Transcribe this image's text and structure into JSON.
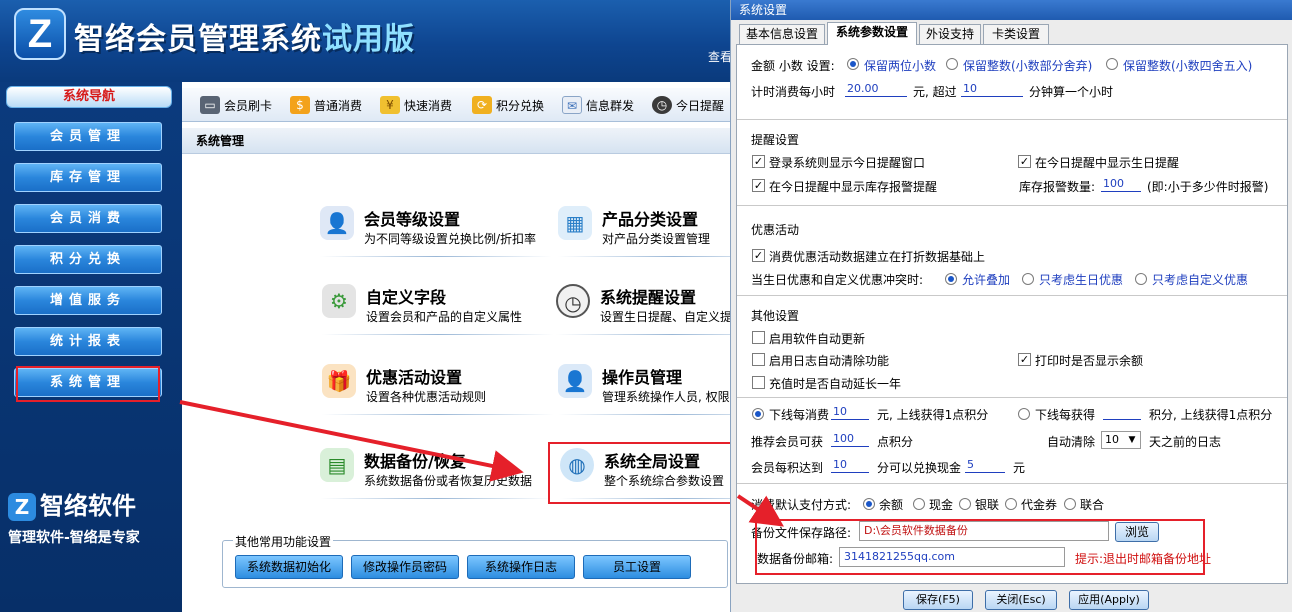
{
  "app": {
    "title_main": "智络会员管理系统",
    "title_trial": "试用版",
    "banner_link": "查看"
  },
  "sidebar": {
    "header": "系统导航",
    "items": [
      {
        "label": "会员管理"
      },
      {
        "label": "库存管理"
      },
      {
        "label": "会员消费"
      },
      {
        "label": "积分兑换"
      },
      {
        "label": "增值服务"
      },
      {
        "label": "统计报表"
      },
      {
        "label": "系统管理"
      }
    ],
    "brand_name": "智络软件",
    "brand_slogan": "管理软件-智络是专家"
  },
  "toolbar": {
    "items": [
      {
        "label": "会员刷卡",
        "icon": "card-icon"
      },
      {
        "label": "普通消费",
        "icon": "money-bag-icon"
      },
      {
        "label": "快速消费",
        "icon": "coins-icon"
      },
      {
        "label": "积分兑换",
        "icon": "exchange-icon"
      },
      {
        "label": "信息群发",
        "icon": "envelope-icon"
      },
      {
        "label": "今日提醒",
        "icon": "clock-icon"
      }
    ]
  },
  "content": {
    "title": "系统管理",
    "features": [
      {
        "title": "会员等级设置",
        "desc": "为不同等级设置兑换比例/折扣率",
        "icon": "user-settings-icon"
      },
      {
        "title": "产品分类设置",
        "desc": "对产品分类设置管理",
        "icon": "category-icon"
      },
      {
        "title": "自定义字段",
        "desc": "设置会员和产品的自定义属性",
        "icon": "gear-download-icon"
      },
      {
        "title": "系统提醒设置",
        "desc": "设置生日提醒、自定义提",
        "icon": "clock-icon"
      },
      {
        "title": "优惠活动设置",
        "desc": "设置各种优惠活动规则",
        "icon": "gift-icon"
      },
      {
        "title": "操作员管理",
        "desc": "管理系统操作人员, 权限分",
        "icon": "operator-icon"
      },
      {
        "title": "数据备份/恢复",
        "desc": "系统数据备份或者恢复历史数据",
        "icon": "backup-icon"
      },
      {
        "title": "系统全局设置",
        "desc": "整个系统综合参数设置",
        "icon": "globe-icon"
      }
    ],
    "other_group_title": "其他常用功能设置",
    "other_buttons": [
      "系统数据初始化",
      "修改操作员密码",
      "系统操作日志",
      "员工设置"
    ]
  },
  "dialog": {
    "title": "系统设置",
    "tabs": [
      "基本信息设置",
      "系统参数设置",
      "外设支持",
      "卡类设置"
    ],
    "active_tab": 1,
    "amount": {
      "label": "金额 小数 设置:",
      "options": [
        "保留两位小数",
        "保留整数(小数部分舍弃)",
        "保留整数(小数四舍五入)"
      ],
      "selected": 0
    },
    "timing": {
      "prefix": "计时消费每小时",
      "price": "20.00",
      "mid": "元, 超过",
      "minutes": "10",
      "suffix": "分钟算一个小时"
    },
    "reminder": {
      "title": "提醒设置",
      "items": [
        {
          "label": "登录系统则显示今日提醒窗口",
          "checked": true
        },
        {
          "label": "在今日提醒中显示生日提醒",
          "checked": true
        },
        {
          "label": "在今日提醒中显示库存报警提醒",
          "checked": true
        }
      ],
      "stock_label": "库存报警数量:",
      "stock_value": "100",
      "stock_hint": "(即:小于多少件时报警)"
    },
    "promo": {
      "title": "优惠活动",
      "check_label": "消费优惠活动数据建立在打折数据基础上",
      "checked": true,
      "conflict_label": "当生日优惠和自定义优惠冲突时:",
      "options": [
        "允许叠加",
        "只考虑生日优惠",
        "只考虑自定义优惠"
      ],
      "selected": 0
    },
    "other": {
      "title": "其他设置",
      "checks": [
        {
          "label": "启用软件自动更新",
          "checked": false
        },
        {
          "label": "启用日志自动清除功能",
          "checked": false
        },
        {
          "label": "打印时是否显示余额",
          "checked": true
        },
        {
          "label": "充值时是否自动延长一年",
          "checked": false
        }
      ],
      "points_a_prefix": "下线每消费",
      "points_a_value": "10",
      "points_a_suffix": "元, 上线获得1点积分",
      "points_b_prefix": "下线每获得",
      "points_b_value": "",
      "points_b_suffix": "积分, 上线获得1点积分",
      "points_selected": 0,
      "recommend_prefix": "推荐会员可获",
      "recommend_value": "100",
      "recommend_suffix": "点积分",
      "autoclean_prefix": "自动清除",
      "autoclean_value": "10",
      "autoclean_suffix": "天之前的日志",
      "accum_prefix": "会员每积达到",
      "accum_value": "10",
      "accum_mid": "分可以兑换现金",
      "accum_cash": "5",
      "accum_suffix": "元",
      "pay_label": "消费默认支付方式:",
      "pay_options": [
        "余额",
        "现金",
        "银联",
        "代金券",
        "联合"
      ],
      "pay_selected": 0,
      "backup_path_label": "备份文件保存路径:",
      "backup_path": "D:\\会员软件数据备份",
      "browse": "浏览",
      "backup_mail_label": "数据备份邮箱:",
      "backup_mail": "3141821255qq.com",
      "backup_hint": "提示:退出时邮箱备份地址"
    },
    "footer": [
      "保存(F5)",
      "关闭(Esc)",
      "应用(Apply)"
    ]
  },
  "colors": {
    "banner": "#0e4590",
    "sidebar": "#072f68",
    "highlight": "#e5202a",
    "accent_blue": "#1f3fbf"
  }
}
